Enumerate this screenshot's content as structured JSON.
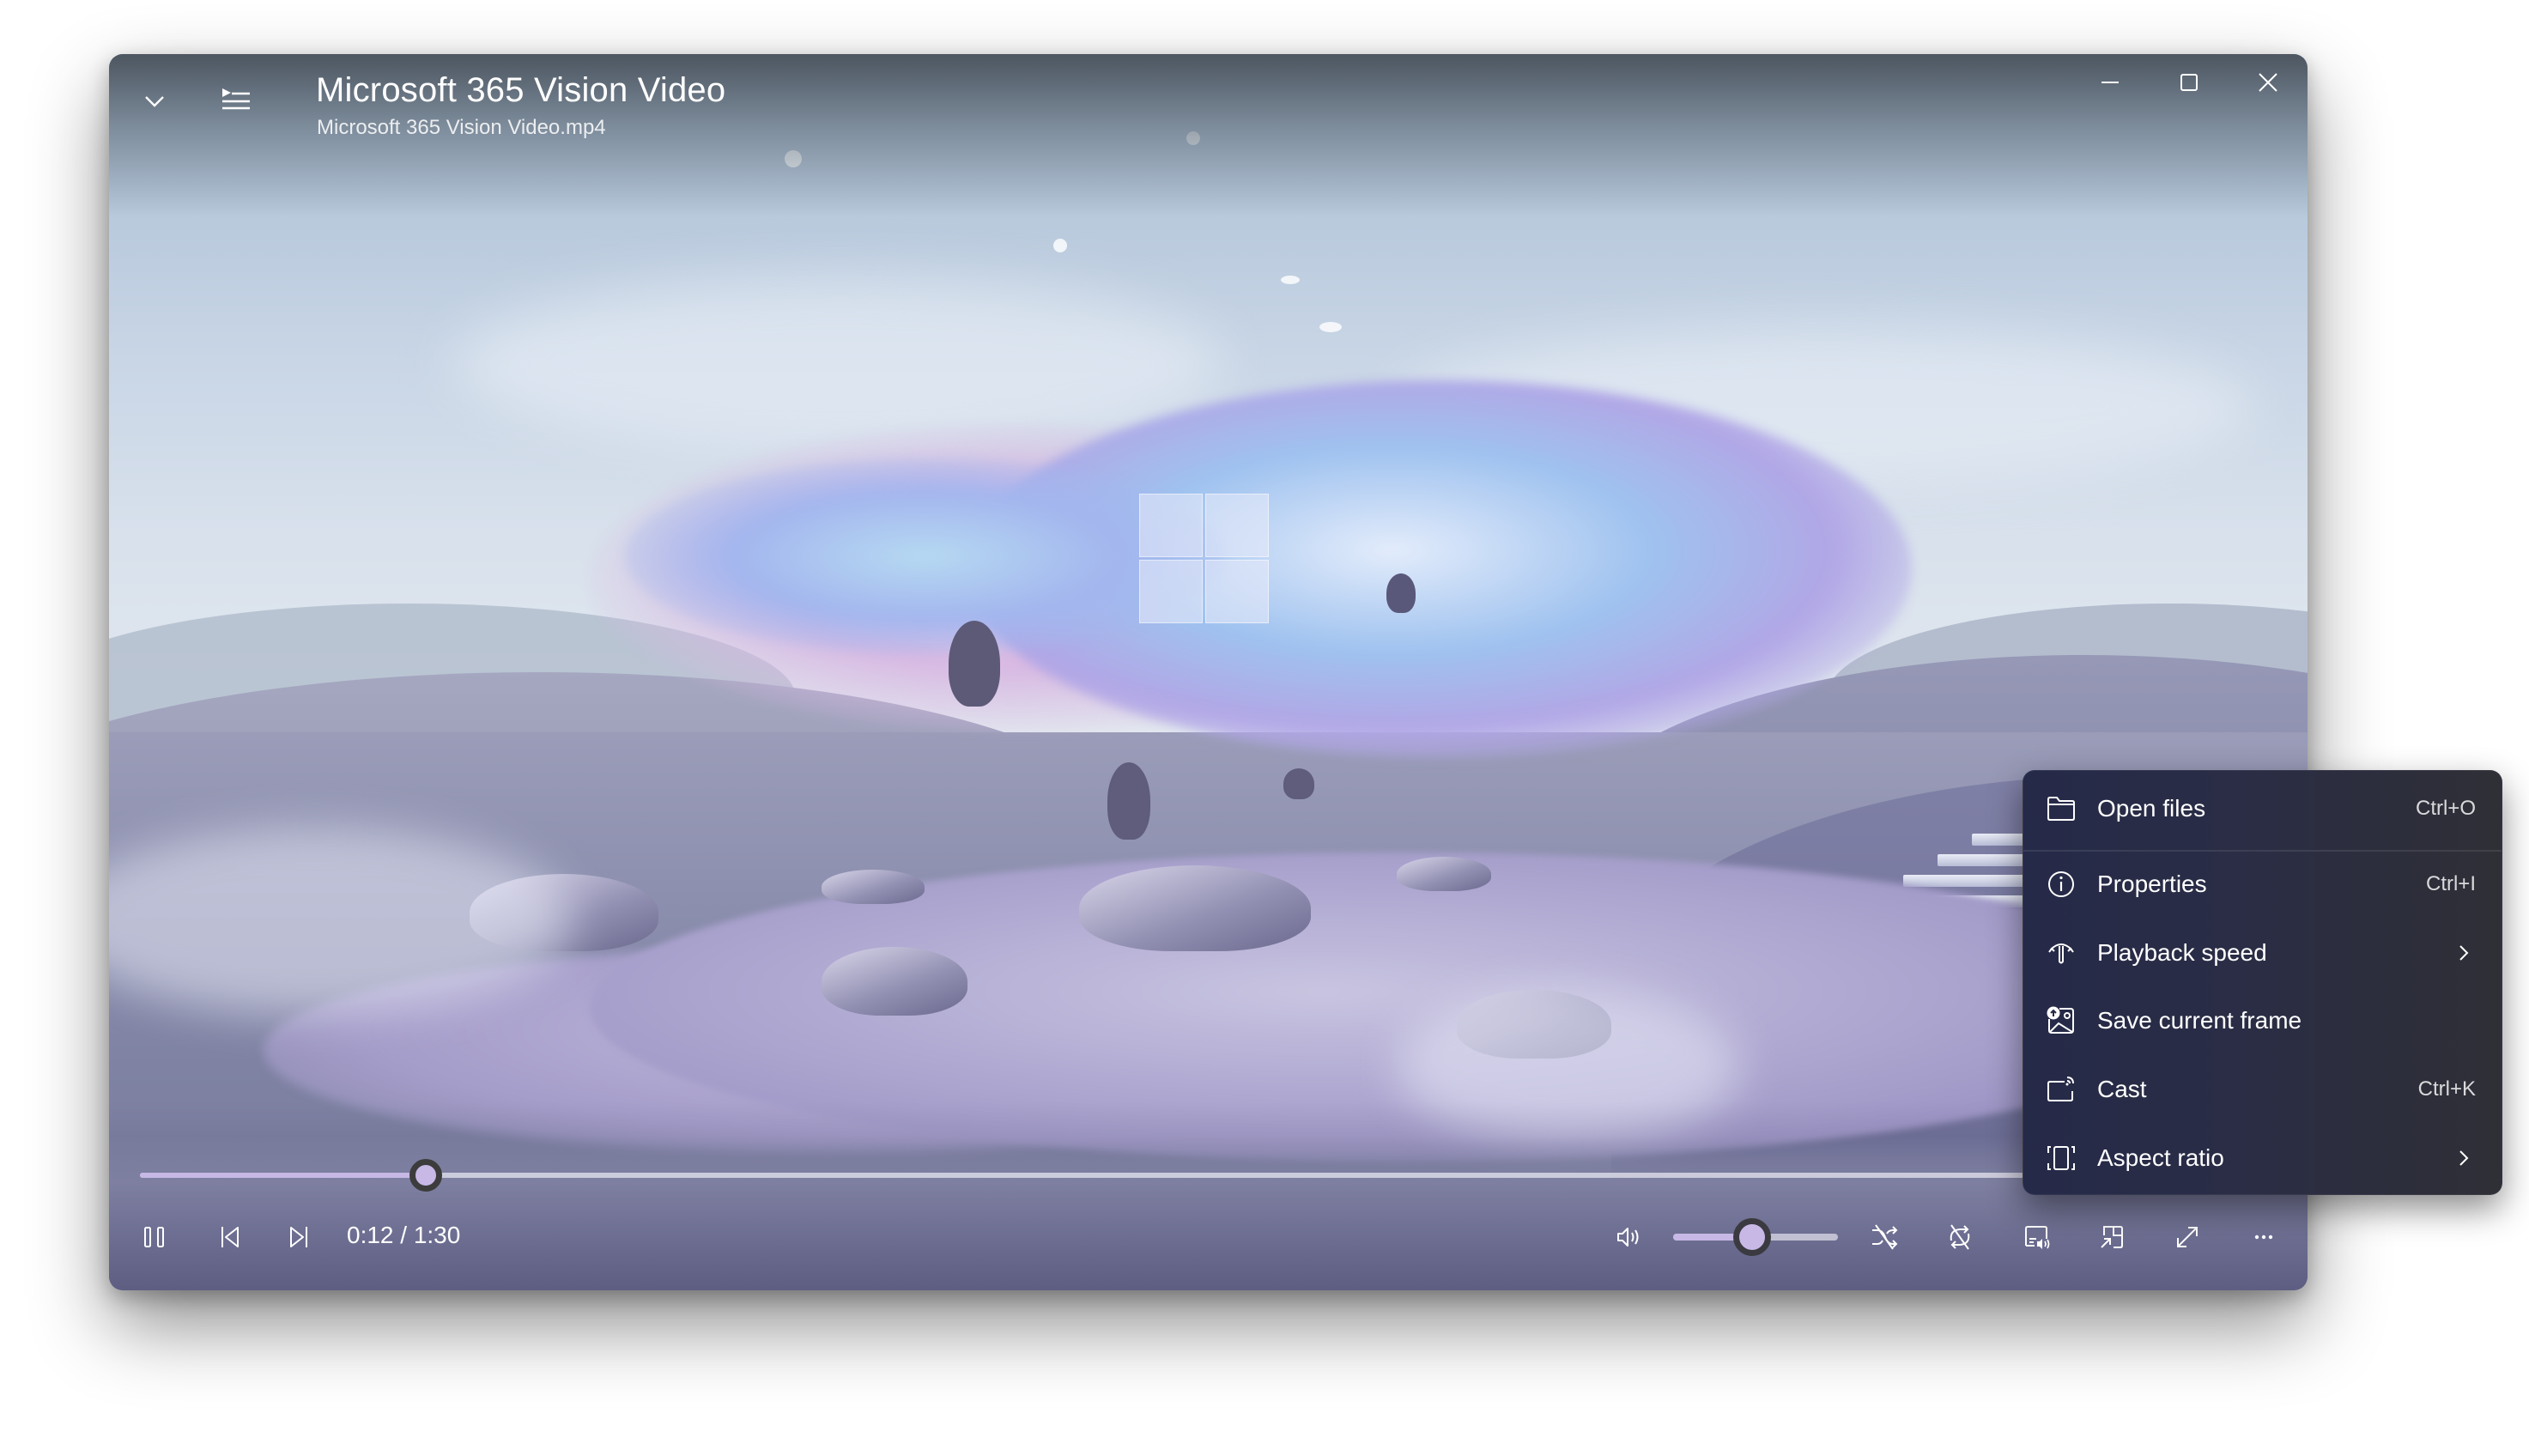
{
  "window": {
    "title": "Microsoft 365 Vision Video",
    "subtitle": "Microsoft 365 Vision Video.mp4",
    "controls": {
      "minimize_icon": "minimize-icon",
      "maximize_icon": "maximize-icon",
      "close_icon": "close-icon"
    },
    "header_icons": [
      "chevron-down-icon",
      "playlist-icon"
    ]
  },
  "player": {
    "current_time": "0:12",
    "total_time": "1:30",
    "time_display": "0:12 / 1:30",
    "progress_fraction": 0.133,
    "volume_fraction": 0.48,
    "accent_color": "#c7b8e6",
    "left_controls": [
      "pause-icon",
      "previous-icon",
      "next-icon"
    ],
    "right_controls": [
      "volume-icon",
      "shuffle-off-icon",
      "repeat-off-icon",
      "cast-to-device-icon",
      "mini-player-icon",
      "fullscreen-icon",
      "more-icon"
    ]
  },
  "context_menu": {
    "items": [
      {
        "label": "Open files",
        "shortcut": "Ctrl+O",
        "icon": "folder-icon",
        "submenu": false
      },
      {
        "label": "Properties",
        "shortcut": "Ctrl+I",
        "icon": "info-icon",
        "submenu": false
      },
      {
        "label": "Playback speed",
        "shortcut": "",
        "icon": "speed-icon",
        "submenu": true
      },
      {
        "label": "Save current frame",
        "shortcut": "",
        "icon": "save-frame-icon",
        "submenu": false
      },
      {
        "label": "Cast",
        "shortcut": "Ctrl+K",
        "icon": "cast-icon",
        "submenu": false
      },
      {
        "label": "Aspect ratio",
        "shortcut": "",
        "icon": "aspect-ratio-icon",
        "submenu": true
      }
    ]
  }
}
